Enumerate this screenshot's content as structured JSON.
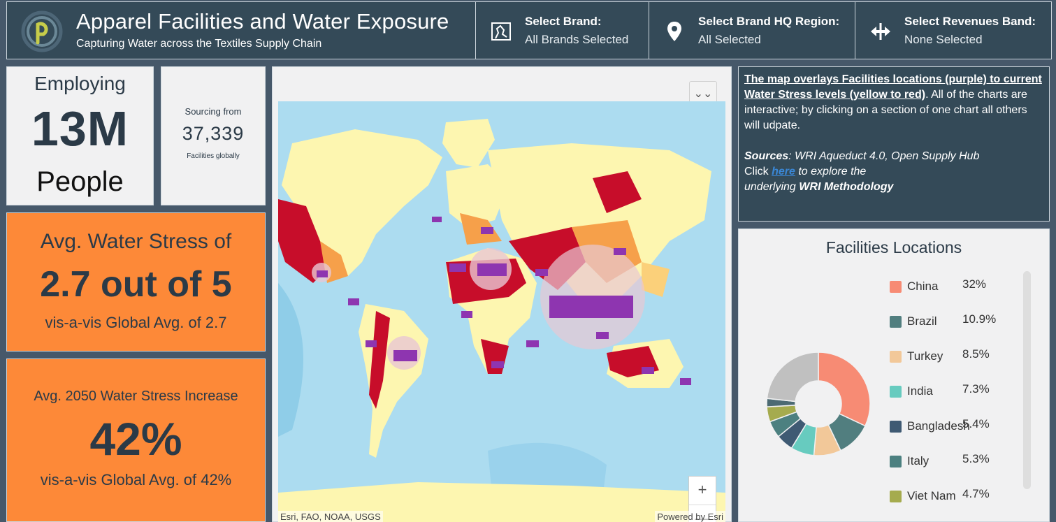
{
  "header": {
    "title": "Apparel Facilities and Water Exposure",
    "subtitle": "Capturing Water across the Textiles Supply Chain",
    "selectors": [
      {
        "title": "Select Brand:",
        "value": "All Brands Selected",
        "icon": "map-icon"
      },
      {
        "title": "Select Brand HQ Region:",
        "value": "All Selected",
        "icon": "location-pin-icon"
      },
      {
        "title": "Select Revenues Band:",
        "value": "None Selected",
        "icon": "horizontal-arrows-icon"
      }
    ]
  },
  "employing": {
    "label": "Employing",
    "value": "13M",
    "unit": "People"
  },
  "sourcing": {
    "label": "Sourcing from",
    "value": "37,339",
    "note": "Facilities globally"
  },
  "water_stress": {
    "label": "Avg. Water Stress of",
    "value": "2.7 out of 5",
    "note": "vis-a-vis Global Avg. of 2.7"
  },
  "stress_increase": {
    "label": "Avg. 2050 Water Stress Increase",
    "value": "42%",
    "note": "vis-a-vis Global Avg. of 42%"
  },
  "map": {
    "attribution": "Esri, FAO, NOAA, USGS",
    "powered_by": "Powered by Esri",
    "zoom_in": "+",
    "zoom_out": "—",
    "collapse": "⌄⌄"
  },
  "info": {
    "lead": "The map overlays Facilities locations (purple) to current Water Stress levels (yellow to red)",
    "body": ". All of the charts are interactive; by clicking on a section of one chart all others will udpate.",
    "sources_label": "Sources",
    "sources_text": ": WRI Aqueduct 4.0, Open Supply Hub",
    "click": "Click ",
    "link": "here",
    "explore": " to explore the",
    "underlying": "underlying ",
    "methodology": "WRI Methodology"
  },
  "chart_data": {
    "type": "pie",
    "title": "Facilities Locations",
    "categories": [
      "China",
      "Brazil",
      "Turkey",
      "India",
      "Bangladesh",
      "Italy",
      "Viet Nam"
    ],
    "values": [
      32,
      10.9,
      8.5,
      7.3,
      5.4,
      5.3,
      4.7
    ],
    "labels": [
      "32%",
      "10.9%",
      "8.5%",
      "7.3%",
      "5.4%",
      "5.3%",
      "4.7%"
    ],
    "colors": [
      "#f78b74",
      "#517e7f",
      "#f2c899",
      "#67cbbf",
      "#3f5a73",
      "#4c8080",
      "#a5ab4e"
    ],
    "other_colors": [
      "#4c6a73",
      "#c0c0c0"
    ],
    "other_value": 25.9,
    "legend_position": "right",
    "donut": true
  }
}
